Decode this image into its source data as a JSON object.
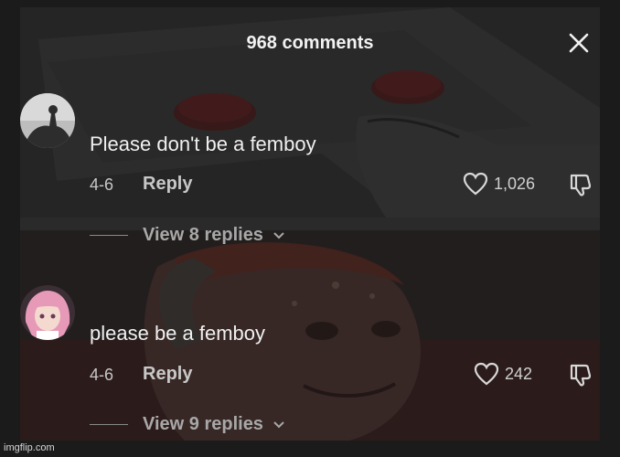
{
  "header": {
    "title": "968 comments",
    "close_icon": "close-icon"
  },
  "comments": [
    {
      "avatar_icon": "avatar-silhouette",
      "text": "Please don't be a femboy",
      "date": "4-6",
      "reply_label": "Reply",
      "likes": "1,026",
      "view_replies": "View 8 replies"
    },
    {
      "avatar_icon": "avatar-anime-character",
      "text": "please be a femboy",
      "date": "4-6",
      "reply_label": "Reply",
      "likes": "242",
      "view_replies": "View 9 replies"
    }
  ],
  "watermark": "imgflip.com",
  "colors": {
    "background": "#1b1b1b",
    "text": "#f0f0f0",
    "muted": "#c8c8c8"
  }
}
